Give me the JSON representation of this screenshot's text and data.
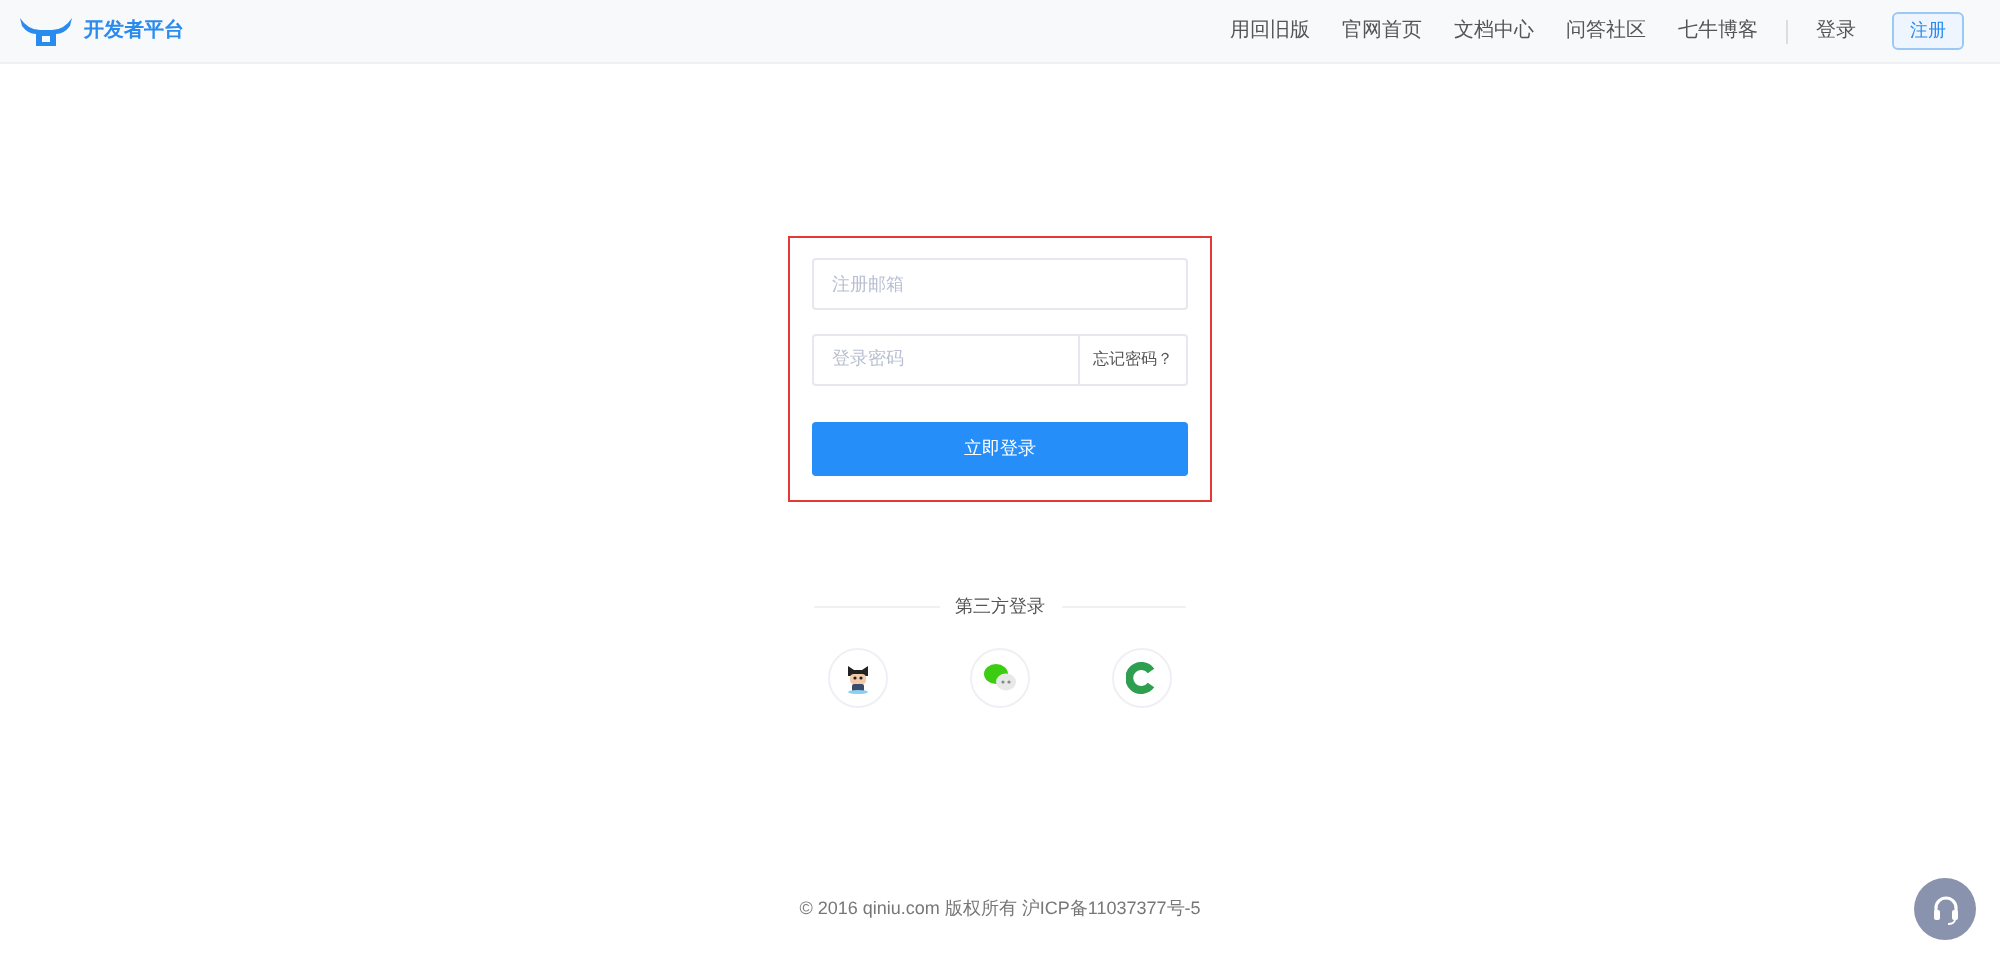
{
  "header": {
    "logo_text": "开发者平台",
    "nav": [
      "用回旧版",
      "官网首页",
      "文档中心",
      "问答社区",
      "七牛博客"
    ],
    "login": "登录",
    "register": "注册"
  },
  "form": {
    "email": {
      "placeholder": "注册邮箱"
    },
    "password": {
      "placeholder": "登录密码"
    },
    "forgot": "忘记密码？",
    "submit": "立即登录"
  },
  "third_party": {
    "title": "第三方登录",
    "providers": [
      {
        "kind": "github"
      },
      {
        "kind": "wechat"
      },
      {
        "kind": "coding"
      }
    ]
  },
  "footer": "© 2016 qiniu.com 版权所有 沪ICP备11037377号-5"
}
